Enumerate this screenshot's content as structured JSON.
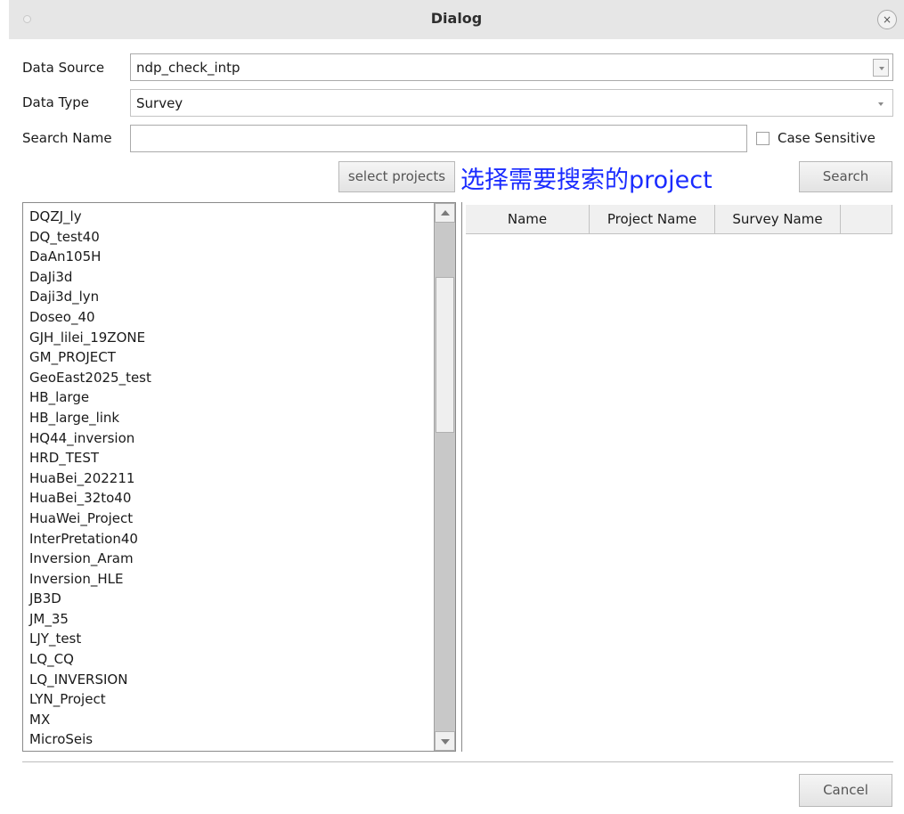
{
  "window": {
    "title": "Dialog",
    "close_icon": "×"
  },
  "form": {
    "data_source": {
      "label": "Data Source",
      "value": "ndp_check_intp"
    },
    "data_type": {
      "label": "Data Type",
      "value": "Survey"
    },
    "search_name": {
      "label": "Search Name",
      "value": ""
    },
    "case_sensitive": {
      "label": "Case Sensitive",
      "checked": false
    }
  },
  "buttons": {
    "select_projects": "select projects",
    "search": "Search",
    "cancel": "Cancel"
  },
  "annotation": "选择需要搜索的project",
  "colors": {
    "annotation": "#1a2bff",
    "titlebar": "#e6e6e6"
  },
  "projects": [
    "DQZJ_ly",
    "DQ_test40",
    "DaAn105H",
    "DaJi3d",
    "Daji3d_lyn",
    "Doseo_40",
    "GJH_lilei_19ZONE",
    "GM_PROJECT",
    "GeoEast2025_test",
    "HB_large",
    "HB_large_link",
    "HQ44_inversion",
    "HRD_TEST",
    "HuaBei_202211",
    "HuaBei_32to40",
    "HuaWei_Project",
    "InterPretation40",
    "Inversion_Aram",
    "Inversion_HLE",
    "JB3D",
    "JM_35",
    "LJY_test",
    "LQ_CQ",
    "LQ_INVERSION",
    "LYN_Project",
    "MX",
    "MicroSeis"
  ],
  "results_table": {
    "columns": [
      "Name",
      "Project Name",
      "Survey Name"
    ],
    "rows": []
  }
}
